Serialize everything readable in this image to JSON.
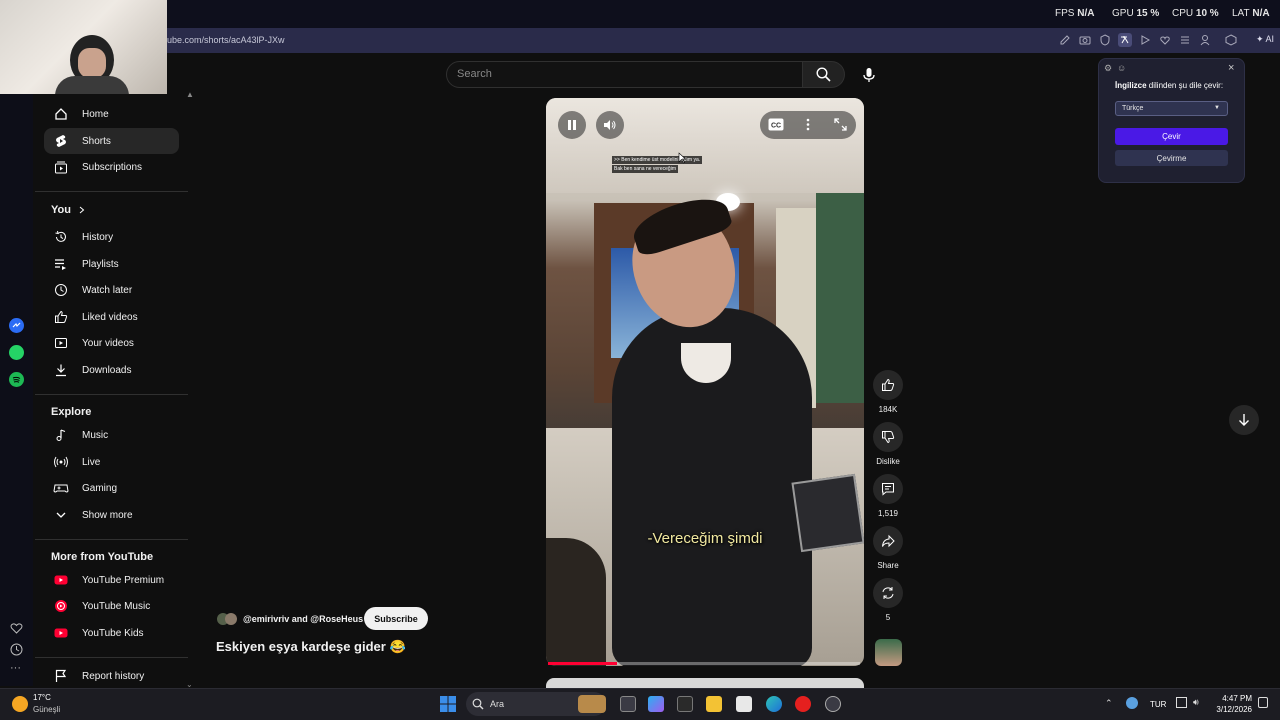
{
  "system_stats": {
    "fps_label": "FPS",
    "fps_value": "N/A",
    "gpu_label": "GPU",
    "gpu_value": "15 %",
    "cpu_label": "CPU",
    "cpu_value": "10 %",
    "lat_label": "LAT",
    "lat_value": "N/A"
  },
  "browser": {
    "url": "ube.com/shorts/acA43lP-JXw",
    "ai_label": "AI"
  },
  "search": {
    "placeholder": "Search"
  },
  "sidebar": {
    "top_items": [
      {
        "label": "Home",
        "icon": "home-icon"
      },
      {
        "label": "Shorts",
        "icon": "shorts-icon",
        "active": true
      },
      {
        "label": "Subscriptions",
        "icon": "subscriptions-icon"
      }
    ],
    "you_header": "You",
    "you_items": [
      {
        "label": "History",
        "icon": "history-icon"
      },
      {
        "label": "Playlists",
        "icon": "playlists-icon"
      },
      {
        "label": "Watch later",
        "icon": "watch-later-icon"
      },
      {
        "label": "Liked videos",
        "icon": "thumbs-up-icon"
      },
      {
        "label": "Your videos",
        "icon": "play-icon"
      },
      {
        "label": "Downloads",
        "icon": "download-icon"
      }
    ],
    "explore_header": "Explore",
    "explore_items": [
      {
        "label": "Music",
        "icon": "music-note-icon"
      },
      {
        "label": "Live",
        "icon": "live-icon"
      },
      {
        "label": "Gaming",
        "icon": "gamepad-icon"
      },
      {
        "label": "Show more",
        "icon": "chevron-down-icon"
      }
    ],
    "more_header": "More from YouTube",
    "more_items": [
      {
        "label": "YouTube Premium",
        "icon": "youtube-premium-icon"
      },
      {
        "label": "YouTube Music",
        "icon": "youtube-music-icon"
      },
      {
        "label": "YouTube Kids",
        "icon": "youtube-kids-icon"
      }
    ],
    "report_item": {
      "label": "Report history",
      "icon": "flag-icon"
    }
  },
  "video": {
    "small_caption_line1": ">> Ben kendime üst modelini aldım ya.",
    "small_caption_line2": "Bak ben sana ne vereceğim",
    "subtitle": "-Vereceğim şimdi",
    "progress": 0.22
  },
  "actions": {
    "likes": "184K",
    "dislike_label": "Dislike",
    "comments": "1,519",
    "share_label": "Share",
    "remix_count": "5"
  },
  "channel": {
    "names": "@emirivriv and @RoseHeus",
    "subscribe_label": "Subscribe",
    "title": "Eskiyen eşya kardeşe gider 😂"
  },
  "translate_popup": {
    "title_bold": "İngilizce",
    "title_rest": " dilinden şu dile çevir:",
    "selected_language": "Türkçe",
    "translate_button": "Çevir",
    "dont_translate_button": "Çevirme"
  },
  "taskbar": {
    "weather_temp": "17°C",
    "weather_cond": "Güneşli",
    "search_text": "Ara",
    "language": "TUR",
    "time": "4:47 PM",
    "date": "3/12/2026"
  },
  "colors": {
    "accent": "#ff0033",
    "translate_primary": "#4a19e6",
    "background": "#0f0f0f"
  }
}
